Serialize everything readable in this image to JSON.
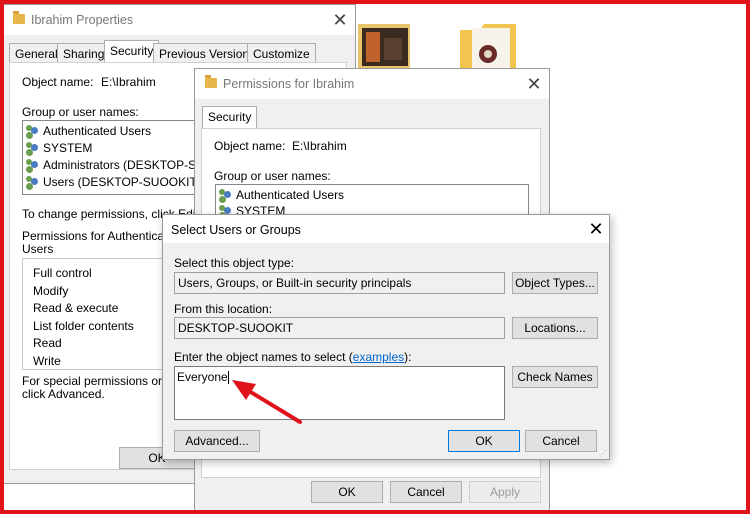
{
  "properties_window": {
    "title": "Ibrahim Properties",
    "tabs": [
      "General",
      "Sharing",
      "Security",
      "Previous Versions",
      "Customize"
    ],
    "object_name_label": "Object name:",
    "object_name_value": "E:\\Ibrahim",
    "group_label": "Group or user names:",
    "users": [
      "Authenticated Users",
      "SYSTEM",
      "Administrators (DESKTOP-SUOO",
      "Users (DESKTOP-SUOOKIT\\Us"
    ],
    "change_perm_text": "To change permissions, click Edit",
    "permissions_for_line1": "Permissions for Authenticated",
    "permissions_for_line2": "Users",
    "permissions": [
      "Full control",
      "Modify",
      "Read & execute",
      "List folder contents",
      "Read",
      "Write"
    ],
    "special_line1": "For special permissions or adva",
    "special_line2": "click Advanced.",
    "ok_label": "OK"
  },
  "permissions_window": {
    "title": "Permissions for Ibrahim",
    "tab": "Security",
    "object_name_label": "Object name:",
    "object_name_value": "E:\\Ibrahim",
    "group_label": "Group or user names:",
    "users": [
      "Authenticated Users",
      "SYSTEM"
    ],
    "ok_label": "OK",
    "cancel_label": "Cancel",
    "apply_label": "Apply"
  },
  "select_dialog": {
    "title": "Select Users or Groups",
    "object_type_label": "Select this object type:",
    "object_type_value": "Users, Groups, or Built-in security principals",
    "object_types_button": "Object Types...",
    "location_label": "From this location:",
    "location_value": "DESKTOP-SUOOKIT",
    "locations_button": "Locations...",
    "enter_names_label": "Enter the object names to select (",
    "examples_link": "examples",
    "enter_names_suffix": "):",
    "names_value": "Everyone",
    "check_names_button": "Check Names",
    "advanced_button": "Advanced...",
    "ok_button": "OK",
    "cancel_button": "Cancel"
  },
  "colors": {
    "frame": "#e0131b",
    "arrow": "#e0131b",
    "link": "#0066cc"
  }
}
